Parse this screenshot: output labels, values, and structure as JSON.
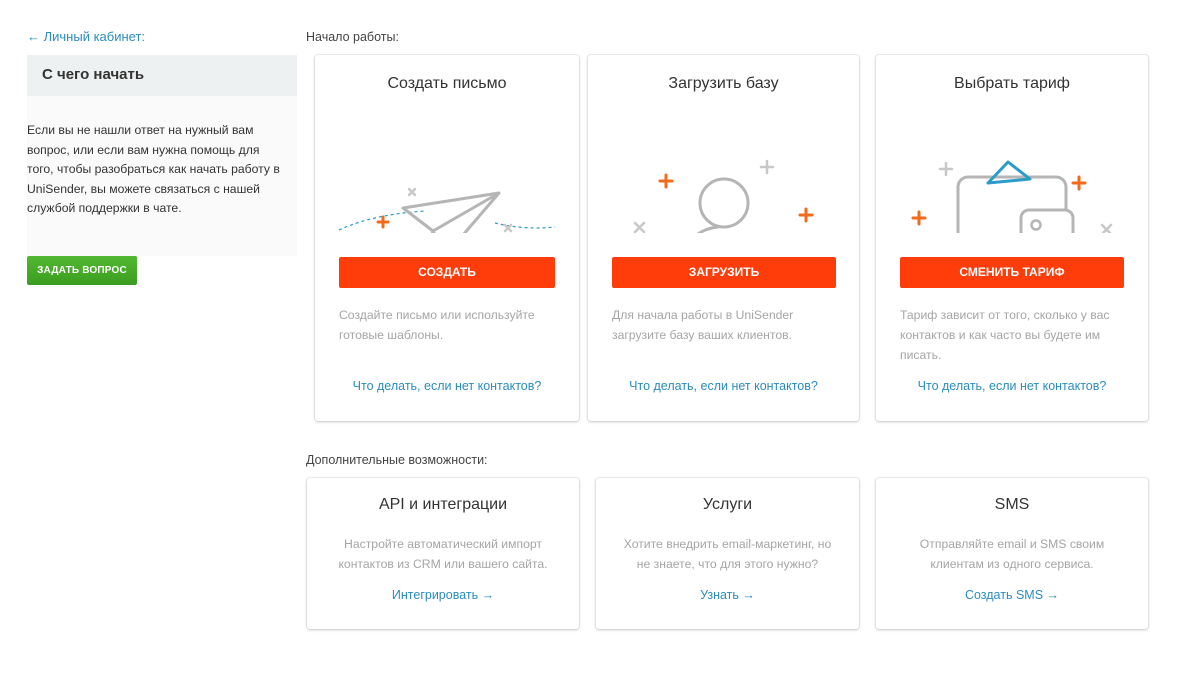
{
  "sidebar": {
    "back_link": "← Личный кабинет:",
    "title": "С чего начать",
    "help_text": "Если вы не нашли ответ на нужный вам вопрос, или если вам нужна помощь для того, чтобы разобраться как начать работу в UniSender, вы можете связаться с нашей службой поддержки в чате.",
    "ask_button": "ЗАДАТЬ ВОПРОС"
  },
  "start": {
    "section_label": "Начало работы:",
    "cards": [
      {
        "title": "Создать письмо",
        "illustration": "paper-plane-icon",
        "button": "СОЗДАТЬ",
        "description": "Создайте письмо или используйте готовые шаблоны.",
        "link": "Что делать, если нет контактов?"
      },
      {
        "title": "Загрузить базу",
        "illustration": "user-add-icon",
        "button": "ЗАГРУЗИТЬ",
        "description": "Для начала работы в UniSender загрузите базу ваших клиентов.",
        "link": "Что делать, если нет контактов?"
      },
      {
        "title": "Выбрать тариф",
        "illustration": "wallet-icon",
        "button": "СМЕНИТЬ ТАРИФ",
        "description": "Тариф зависит от того, сколько у вас контактов и как часто вы будете им писать.",
        "link": "Что делать, если нет контактов?"
      }
    ]
  },
  "extra": {
    "section_label": "Дополнительные возможности:",
    "cards": [
      {
        "title": "API и интеграции",
        "description": "Настройте автоматический импорт контактов из CRM или вашего сайта.",
        "link": "Интегрировать →"
      },
      {
        "title": "Услуги",
        "description": "Хотите внедрить email-маркетинг, но не знаете, что для этого нужно?",
        "link": "Узнать →"
      },
      {
        "title": "SMS",
        "description": "Отправляйте email и SMS своим клиентам из одного сервиса.",
        "link": "Создать SMS →"
      }
    ]
  },
  "colors": {
    "accent_orange": "#ff3d0a",
    "link_blue": "#2b8cbe",
    "green_button": "#48ad27",
    "illustration_gray": "#b5b5b5",
    "plus_orange": "#f26a1b",
    "plus_teal": "#2b9bc7"
  }
}
